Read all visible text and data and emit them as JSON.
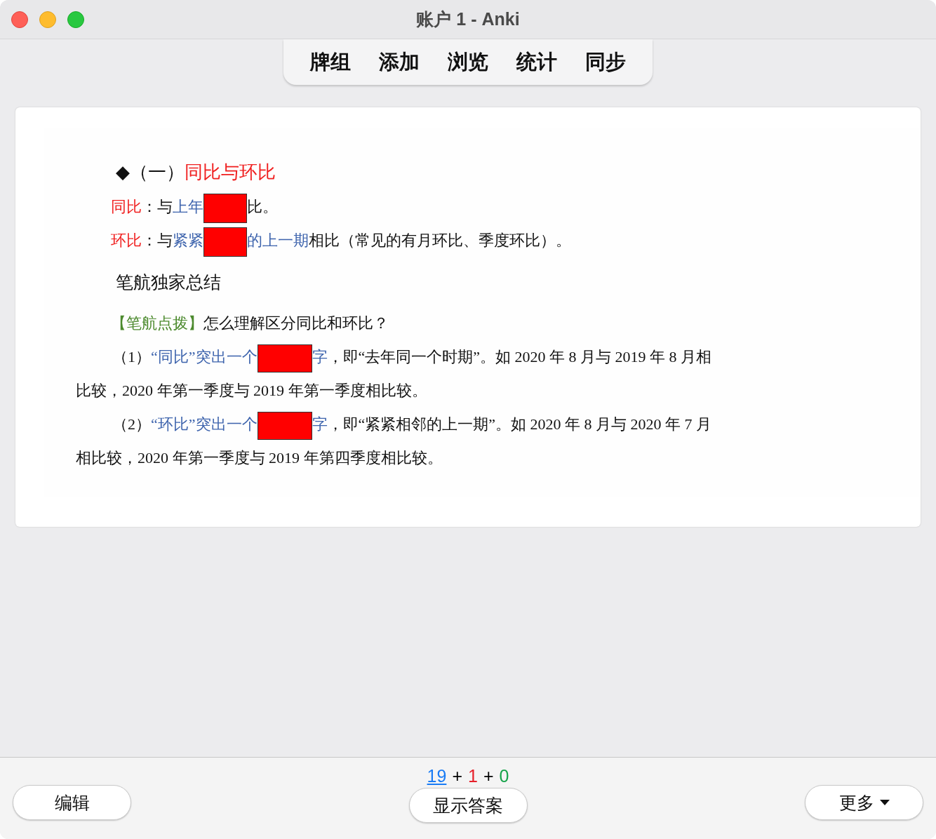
{
  "window": {
    "title": "账户 1 - Anki"
  },
  "tabs": [
    {
      "label": "牌组",
      "selected": false
    },
    {
      "label": "添加",
      "selected": false
    },
    {
      "label": "浏览",
      "selected": false
    },
    {
      "label": "统计",
      "selected": false
    },
    {
      "label": "同步",
      "selected": false
    }
  ],
  "card": {
    "paragraphs": [
      {
        "kind": "heading",
        "runs": [
          {
            "kind": "black",
            "text": "◆（一）"
          },
          {
            "kind": "red",
            "text": "同比与环比"
          }
        ]
      },
      {
        "kind": "line",
        "runs": [
          {
            "kind": "red",
            "text": "同比"
          },
          {
            "kind": "black",
            "text": "：与"
          },
          {
            "kind": "blue",
            "text": "上年"
          },
          {
            "kind": "mask"
          },
          {
            "kind": "black",
            "text": "比。"
          }
        ]
      },
      {
        "kind": "line",
        "runs": [
          {
            "kind": "red",
            "text": "环比"
          },
          {
            "kind": "black",
            "text": "：与"
          },
          {
            "kind": "blue",
            "text": "紧紧"
          },
          {
            "kind": "mask"
          },
          {
            "kind": "blue",
            "text": "的上一期"
          },
          {
            "kind": "black",
            "text": "相比（常见的有月环比、季度环比）。"
          }
        ]
      },
      {
        "kind": "subheading",
        "runs": [
          {
            "kind": "black",
            "text": "笔航独家总结"
          }
        ]
      },
      {
        "kind": "line",
        "runs": [
          {
            "kind": "green",
            "text": "【笔航点拨】"
          },
          {
            "kind": "black",
            "text": "怎么理解区分同比和环比？"
          }
        ]
      },
      {
        "kind": "para",
        "runs": [
          {
            "kind": "black",
            "text": "（1）"
          },
          {
            "kind": "blue",
            "text": "“同比”突出一个"
          },
          {
            "kind": "mask"
          },
          {
            "kind": "blue",
            "text": "字"
          },
          {
            "kind": "black",
            "text": "，即“去年同一个时期”。如 2020 年 8 月与 2019 年 8 月相"
          }
        ]
      },
      {
        "kind": "cont",
        "runs": [
          {
            "kind": "black",
            "text": "比较，2020 年第一季度与 2019 年第一季度相比较。"
          }
        ]
      },
      {
        "kind": "para",
        "runs": [
          {
            "kind": "black",
            "text": "（2）"
          },
          {
            "kind": "blue",
            "text": "“环比”突出一个"
          },
          {
            "kind": "mask"
          },
          {
            "kind": "blue",
            "text": "字"
          },
          {
            "kind": "black",
            "text": "，即“紧紧相邻的上一期”。如 2020 年 8 月与 2020 年 7 月"
          }
        ]
      },
      {
        "kind": "cont",
        "runs": [
          {
            "kind": "black",
            "text": "相比较，2020 年第一季度与 2019 年第四季度相比较。"
          }
        ]
      }
    ]
  },
  "bottom": {
    "edit_button": "编辑",
    "counts": [
      {
        "text": "19",
        "color": "#1a7cf5",
        "link": true
      },
      {
        "text": "+",
        "color": "#000000",
        "link": false
      },
      {
        "text": "1",
        "color": "#e6202a",
        "link": false
      },
      {
        "text": "+",
        "color": "#000000",
        "link": false
      },
      {
        "text": "0",
        "color": "#16a34a",
        "link": false
      }
    ],
    "show_answer_button": "显示答案",
    "more_button": "更多"
  }
}
